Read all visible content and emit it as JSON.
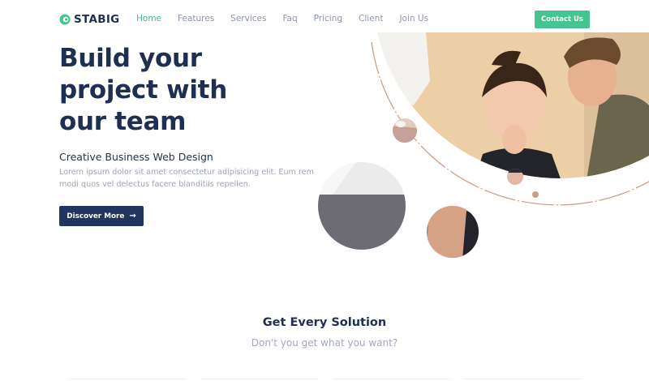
{
  "brand": {
    "name": "STABIG",
    "logo_icon": "logo-icon",
    "accent": "#45c48f",
    "primary": "#21365f"
  },
  "nav": {
    "items": [
      {
        "label": "Home",
        "active": true
      },
      {
        "label": "Features",
        "active": false
      },
      {
        "label": "Services",
        "active": false
      },
      {
        "label": "Faq",
        "active": false
      },
      {
        "label": "Pricing",
        "active": false
      },
      {
        "label": "Client",
        "active": false
      },
      {
        "label": "Join Us",
        "active": false
      }
    ],
    "contact_label": "Contact Us"
  },
  "hero": {
    "title_line1": "Build your",
    "title_line2": "project with",
    "title_line3": "our team",
    "subtitle": "Creative Business Web Design",
    "description": "Lorem ipsum dolor sit amet consectetur adipisicing elit. Eum rem modi quos vel delectus facere blanditiis repellen.",
    "cta_label": "Discover More",
    "cta_icon": "arrow-right-icon"
  },
  "section": {
    "title": "Get Every Solution",
    "subtitle": "Don't you get what you want?"
  }
}
